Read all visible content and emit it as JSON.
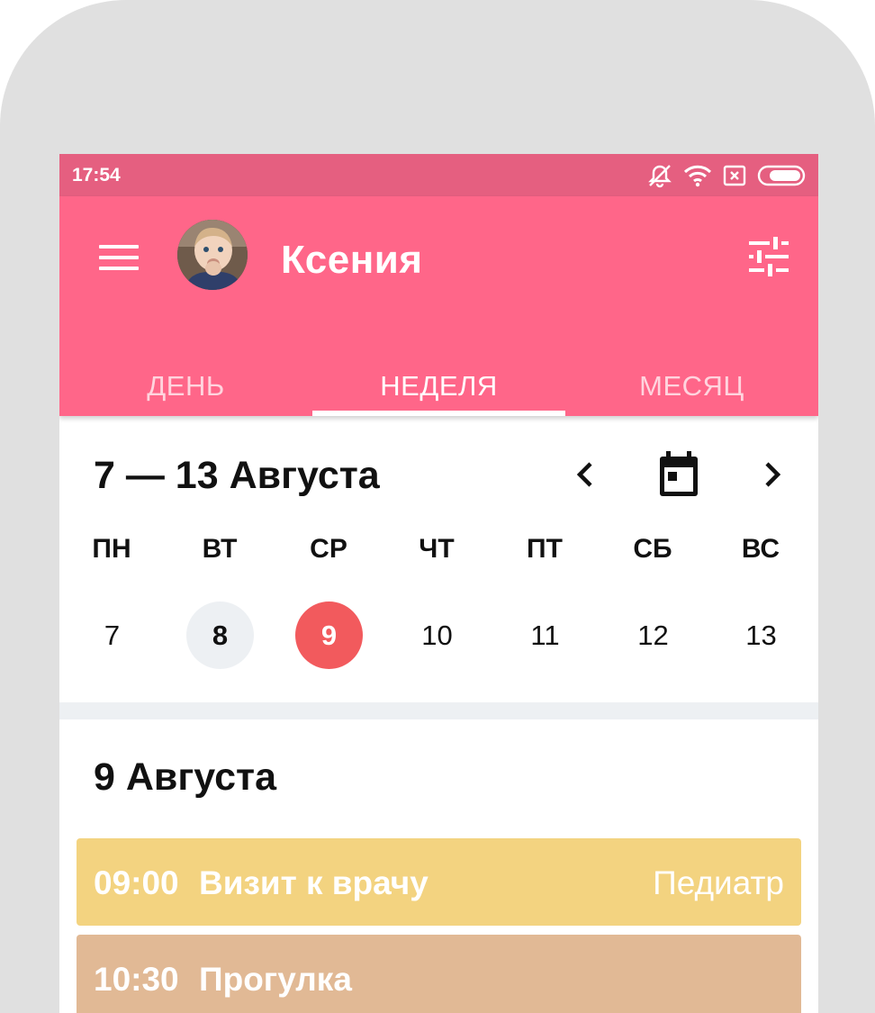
{
  "status_bar": {
    "time": "17:54",
    "icons": [
      "notifications-off-icon",
      "wifi-icon",
      "no-sim-icon",
      "battery-icon"
    ]
  },
  "app_bar": {
    "title": "Ксения",
    "menu_icon": "menu-icon",
    "filter_icon": "tune-icon",
    "color": "#ff6689",
    "status_color": "#e55f80"
  },
  "tabs": [
    {
      "label": "ДЕНЬ",
      "active": false
    },
    {
      "label": "НЕДЕЛЯ",
      "active": true
    },
    {
      "label": "МЕСЯЦ",
      "active": false
    }
  ],
  "week": {
    "range": "7 — 13 Августа",
    "prev_icon": "chevron-left-icon",
    "calendar_icon": "calendar-icon",
    "next_icon": "chevron-right-icon",
    "day_names": [
      "ПН",
      "ВТ",
      "СР",
      "ЧТ",
      "ПТ",
      "СБ",
      "ВС"
    ],
    "dates": [
      "7",
      "8",
      "9",
      "10",
      "11",
      "12",
      "13"
    ],
    "highlighted_date": "8",
    "selected_date": "9",
    "selected_color": "#f25a5d"
  },
  "day": {
    "title": "9 Августа",
    "events": [
      {
        "time": "09:00",
        "name": "Визит к врачу",
        "category": "Педиатр",
        "color": "#f3d380"
      },
      {
        "time": "10:30",
        "name": "Прогулка",
        "category": "",
        "color": "#e1b995"
      }
    ]
  }
}
